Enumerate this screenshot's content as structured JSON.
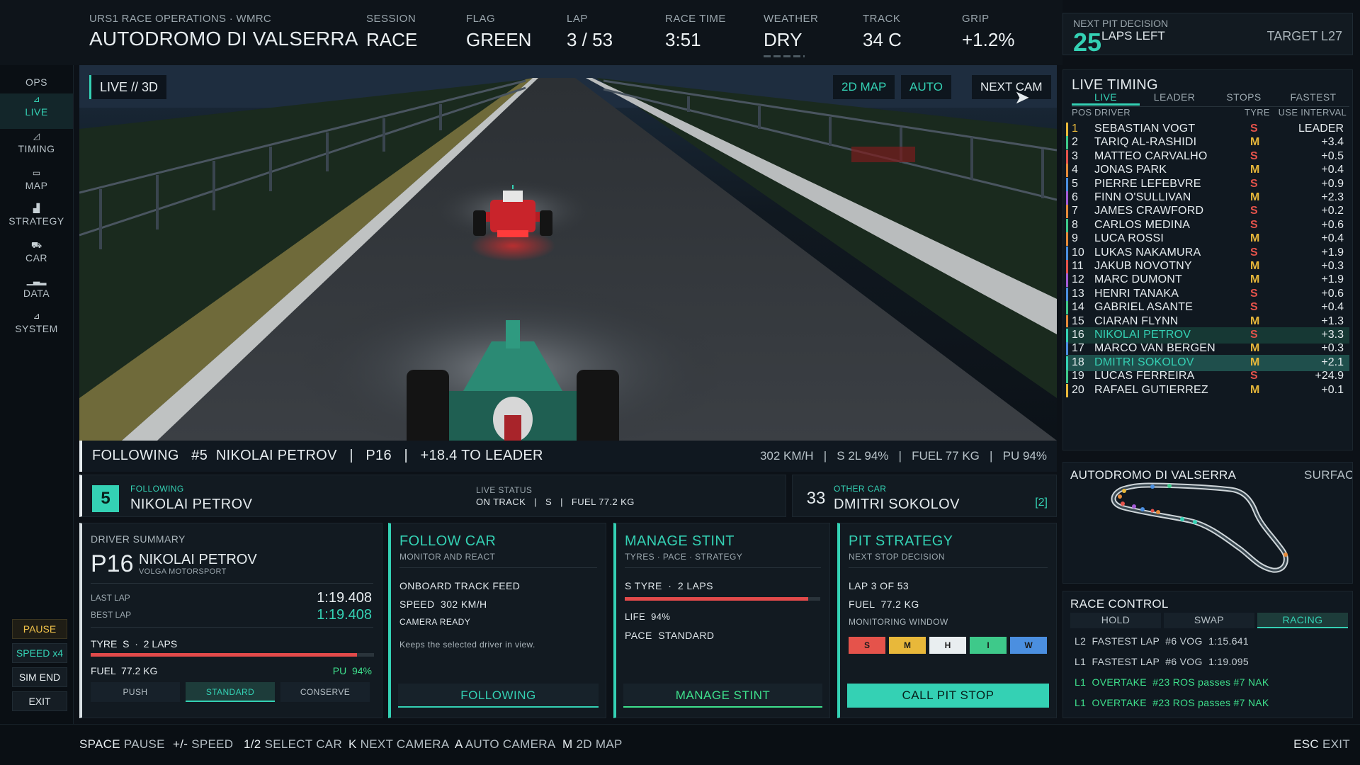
{
  "header": {
    "subtitle": "URS1 RACE OPERATIONS · WMRC",
    "title": "AUTODROMO DI VALSERRA",
    "stats": [
      {
        "label": "SESSION",
        "value": "RACE"
      },
      {
        "label": "FLAG",
        "value": "GREEN"
      },
      {
        "label": "LAP",
        "value": "3 / 53"
      },
      {
        "label": "RACE TIME",
        "value": "3:51"
      },
      {
        "label": "WEATHER",
        "value": "DRY"
      },
      {
        "label": "TRACK",
        "value": "34 C"
      },
      {
        "label": "GRIP",
        "value": "+1.2%"
      }
    ],
    "next_pit": {
      "label": "NEXT PIT DECISION",
      "laps": "25",
      "laps_label": "LAPS LEFT",
      "target": "TARGET L27"
    }
  },
  "nav": {
    "items": [
      {
        "label": "OPS"
      },
      {
        "label": "LIVE"
      },
      {
        "label": "TIMING"
      },
      {
        "label": "MAP"
      },
      {
        "label": "STRATEGY"
      },
      {
        "label": "CAR"
      },
      {
        "label": "DATA"
      },
      {
        "label": "SYSTEM"
      }
    ],
    "buttons": {
      "pause": "PAUSE",
      "speed": "SPEED x4",
      "sim_end": "SIM END",
      "exit": "EXIT"
    }
  },
  "viewport": {
    "tag": "LIVE // 3D",
    "buttons": {
      "map": "2D MAP",
      "auto": "AUTO",
      "next_cam": "NEXT CAM"
    },
    "follow_left": "FOLLOWING   #5  NIKOLAI PETROV   |   P16   |   +18.4 TO LEADER",
    "follow_right": "302 KM/H   |   S 2L 94%   |   FUEL 77 KG   |   PU 94%"
  },
  "selected": {
    "number": "5",
    "small": "FOLLOWING",
    "name": "NIKOLAI PETROV",
    "live_status_label": "LIVE STATUS",
    "live_status_value": "ON TRACK   |   S   |   FUEL 77.2 KG"
  },
  "other": {
    "number": "33",
    "small": "OTHER CAR",
    "name": "DMITRI SOKOLOV",
    "tag": "[2]"
  },
  "driver_summary": {
    "header": "DRIVER SUMMARY",
    "position": "P16",
    "name": "NIKOLAI PETROV",
    "team": "VOLGA MOTORSPORT",
    "last_lap_label": "LAST LAP",
    "last_lap": "1:19.408",
    "best_lap_label": "BEST LAP",
    "best_lap": "1:19.408",
    "tyre": "TYRE  S  ·  2 LAPS",
    "tyre_life": 0.94,
    "fuel": "FUEL  77.2 KG",
    "pu": "PU  94%",
    "modes": [
      "PUSH",
      "STANDARD",
      "CONSERVE"
    ],
    "active_mode": "STANDARD"
  },
  "follow_car": {
    "title": "FOLLOW CAR",
    "sub": "MONITOR AND REACT",
    "feed": "ONBOARD TRACK FEED",
    "speed": "SPEED  302 KM/H",
    "camera": "CAMERA READY",
    "desc": "Keeps the selected driver in view.",
    "action": "FOLLOWING"
  },
  "manage_stint": {
    "title": "MANAGE STINT",
    "sub": "TYRES · PACE · STRATEGY",
    "tyre": "S TYRE  ·  2 LAPS",
    "life": "LIFE  94%",
    "life_value": 0.94,
    "pace": "PACE  STANDARD",
    "action": "MANAGE STINT"
  },
  "pit_strategy": {
    "title": "PIT STRATEGY",
    "sub": "NEXT STOP DECISION",
    "lap": "LAP 3 OF 53",
    "fuel": "FUEL  77.2 KG",
    "window": "MONITORING WINDOW",
    "compounds": [
      {
        "label": "S",
        "color": "#e5534b"
      },
      {
        "label": "M",
        "color": "#e8b83a"
      },
      {
        "label": "H",
        "color": "#e9eef0"
      },
      {
        "label": "I",
        "color": "#3ec98a"
      },
      {
        "label": "W",
        "color": "#4b8fe0"
      }
    ],
    "action": "CALL PIT STOP"
  },
  "timing": {
    "title": "LIVE TIMING",
    "tabs": [
      "LIVE",
      "LEADER",
      "STOPS",
      "FASTEST"
    ],
    "columns": {
      "pos": "POS",
      "driver": "DRIVER",
      "tyre": "TYRE",
      "use_interval": "USE INTERVAL"
    },
    "rows": [
      {
        "pos": "1",
        "driver": "SEBASTIAN VOGT",
        "tyre": "S",
        "interval": "LEADER",
        "stripe": "#e8b83a"
      },
      {
        "pos": "2",
        "driver": "TARIQ AL-RASHIDI",
        "tyre": "M",
        "interval": "+3.4",
        "stripe": "#3ec98a"
      },
      {
        "pos": "3",
        "driver": "MATTEO CARVALHO",
        "tyre": "S",
        "interval": "+0.5",
        "stripe": "#e5534b"
      },
      {
        "pos": "4",
        "driver": "JONAS PARK",
        "tyre": "M",
        "interval": "+0.4",
        "stripe": "#e58a3a"
      },
      {
        "pos": "5",
        "driver": "PIERRE LEFEBVRE",
        "tyre": "S",
        "interval": "+0.9",
        "stripe": "#4b8fe0"
      },
      {
        "pos": "6",
        "driver": "FINN O'SULLIVAN",
        "tyre": "M",
        "interval": "+2.3",
        "stripe": "#a35bd6"
      },
      {
        "pos": "7",
        "driver": "JAMES CRAWFORD",
        "tyre": "S",
        "interval": "+0.2",
        "stripe": "#e58a3a"
      },
      {
        "pos": "8",
        "driver": "CARLOS MEDINA",
        "tyre": "S",
        "interval": "+0.6",
        "stripe": "#3ec98a"
      },
      {
        "pos": "9",
        "driver": "LUCA ROSSI",
        "tyre": "M",
        "interval": "+0.4",
        "stripe": "#e58a3a"
      },
      {
        "pos": "10",
        "driver": "LUKAS NAKAMURA",
        "tyre": "S",
        "interval": "+1.9",
        "stripe": "#4b8fe0"
      },
      {
        "pos": "11",
        "driver": "JAKUB NOVOTNY",
        "tyre": "M",
        "interval": "+0.3",
        "stripe": "#e5534b"
      },
      {
        "pos": "12",
        "driver": "MARC DUMONT",
        "tyre": "M",
        "interval": "+1.9",
        "stripe": "#a35bd6"
      },
      {
        "pos": "13",
        "driver": "HENRI TANAKA",
        "tyre": "S",
        "interval": "+0.6",
        "stripe": "#4b8fe0"
      },
      {
        "pos": "14",
        "driver": "GABRIEL ASANTE",
        "tyre": "S",
        "interval": "+0.4",
        "stripe": "#3ec98a"
      },
      {
        "pos": "15",
        "driver": "CIARAN FLYNN",
        "tyre": "M",
        "interval": "+1.3",
        "stripe": "#e58a3a"
      },
      {
        "pos": "16",
        "driver": "NIKOLAI PETROV",
        "tyre": "S",
        "interval": "+3.3",
        "stripe": "#34d1b4"
      },
      {
        "pos": "17",
        "driver": "MARCO VAN BERGEN",
        "tyre": "M",
        "interval": "+0.3",
        "stripe": "#4b8fe0"
      },
      {
        "pos": "18",
        "driver": "DMITRI SOKOLOV",
        "tyre": "M",
        "interval": "+2.1",
        "stripe": "#34d1b4"
      },
      {
        "pos": "19",
        "driver": "LUCAS FERREIRA",
        "tyre": "S",
        "interval": "+24.9",
        "stripe": "#3ec98a"
      },
      {
        "pos": "20",
        "driver": "RAFAEL GUTIERREZ",
        "tyre": "M",
        "interval": "+0.1",
        "stripe": "#e8b83a"
      }
    ]
  },
  "track_map": {
    "title": "AUTODROMO DI VALSERRA",
    "surface": "SURFACE"
  },
  "race_control": {
    "title": "RACE CONTROL",
    "tabs": [
      "HOLD",
      "SWAP",
      "RACING"
    ],
    "messages": [
      {
        "text": "L2  FASTEST LAP  #6 VOG  1:15.641"
      },
      {
        "text": "L1  FASTEST LAP  #6 VOG  1:19.095"
      },
      {
        "text": "L1  OVERTAKE  #23 ROS passes #7 NAK"
      },
      {
        "text": "L1  OVERTAKE  #23 ROS passes #7 NAK"
      }
    ]
  },
  "hotkeys": [
    {
      "key": "SPACE",
      "label": "PAUSE"
    },
    {
      "key": "+/-",
      "label": "SPEED"
    },
    {
      "key": "1/2",
      "label": "SELECT CAR"
    },
    {
      "key": "K",
      "label": "NEXT CAMERA"
    },
    {
      "key": "A",
      "label": "AUTO CAMERA"
    },
    {
      "key": "M",
      "label": "2D MAP"
    }
  ],
  "exit_hotkey": {
    "key": "ESC",
    "label": "EXIT"
  },
  "colors": {
    "accent": "#34d1b4",
    "flag_green": "#3ee08c",
    "dry": "#f0c24a",
    "soft": "#e5534b",
    "medium": "#e8b83a"
  }
}
